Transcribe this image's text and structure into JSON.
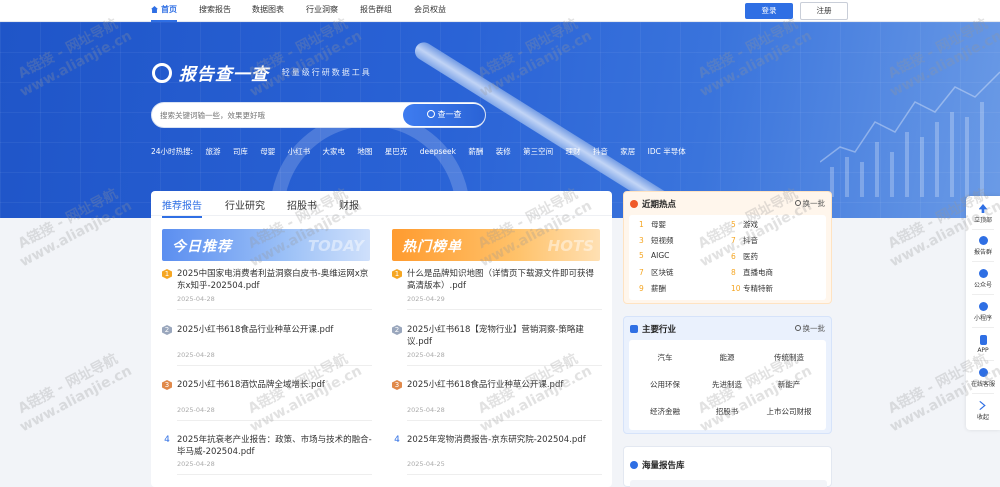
{
  "nav": {
    "items": [
      {
        "label": "首页",
        "active": true
      },
      {
        "label": "搜索报告"
      },
      {
        "label": "数据图表"
      },
      {
        "label": "行业洞察"
      },
      {
        "label": "报告群组"
      },
      {
        "label": "会员权益"
      }
    ],
    "login": "登录",
    "register": "注册"
  },
  "hero": {
    "logo_title": "报告查一查",
    "logo_subtitle": "轻量级行研数据工具",
    "search_placeholder": "搜索关键词输一些，效果更好哦",
    "search_button": "查一查",
    "hot_label": "24小时热搜:",
    "hot_terms": [
      "旅游",
      "司库",
      "母婴",
      "小红书",
      "大家电",
      "地图",
      "星巴克",
      "deepseek",
      "薪酬",
      "装修",
      "第三空间",
      "理财",
      "抖音",
      "家居",
      "IDC 半导体"
    ]
  },
  "main": {
    "tabs": [
      "推荐报告",
      "行业研究",
      "招股书",
      "财报"
    ],
    "today": {
      "banner": "今日推荐",
      "banner_bg": "TODAY",
      "items": [
        {
          "rank": "1",
          "title": "2025中国家电消费者利益洞察白皮书-奥维运网x京东x知乎-202504.pdf",
          "date": "2025-04-28"
        },
        {
          "rank": "2",
          "title": "2025小红书618食品行业种草公开课.pdf",
          "date": "2025-04-28"
        },
        {
          "rank": "3",
          "title": "2025小红书618酒饮品牌全域增长.pdf",
          "date": "2025-04-28"
        },
        {
          "rank": "4",
          "title": "2025年抗衰老产业报告：政策、市场与技术的融合-毕马威-202504.pdf",
          "date": "2025-04-28"
        }
      ]
    },
    "hot": {
      "banner": "热门榜单",
      "banner_bg": "HOTS",
      "items": [
        {
          "rank": "1",
          "title": "什么是品牌知识地图（详情页下载源文件即可获得高清版本）.pdf",
          "date": "2025-04-29"
        },
        {
          "rank": "2",
          "title": "2025小红书618【宠物行业】营销洞察-策略建议.pdf",
          "date": "2025-04-28"
        },
        {
          "rank": "3",
          "title": "2025小红书618食品行业种草公开课.pdf",
          "date": "2025-04-28"
        },
        {
          "rank": "4",
          "title": "2025年宠物消费报告-京东研究院-202504.pdf",
          "date": "2025-04-25"
        }
      ]
    }
  },
  "hot_topics": {
    "title": "近期热点",
    "refresh": "换一批",
    "items": [
      {
        "n": "1",
        "label": "母婴"
      },
      {
        "n": "5",
        "label": "游戏"
      },
      {
        "n": "3",
        "label": "短视频"
      },
      {
        "n": "7",
        "label": "抖音"
      },
      {
        "n": "5",
        "label": "AIGC"
      },
      {
        "n": "6",
        "label": "医药"
      },
      {
        "n": "7",
        "label": "区块链"
      },
      {
        "n": "8",
        "label": "直播电商"
      },
      {
        "n": "9",
        "label": "薪酬"
      },
      {
        "n": "10",
        "label": "专精特新"
      }
    ]
  },
  "industries": {
    "title": "主要行业",
    "refresh": "换一批",
    "items": [
      "汽车",
      "能源",
      "传统制造",
      "公用环保",
      "先进制造",
      "新能产",
      "经济金融",
      "招股书",
      "上市公司财报"
    ]
  },
  "library": {
    "title": "海量报告库"
  },
  "float_bar": [
    "立顶部",
    "报告群",
    "公众号",
    "小程序",
    "APP",
    "在线客服",
    "收起"
  ],
  "watermark": {
    "line1": "A链接 - 网址导航",
    "line2": "www.alianjie.cn"
  },
  "colors": {
    "brand": "#2f6fe4",
    "hot_accent": "#f5a623"
  }
}
